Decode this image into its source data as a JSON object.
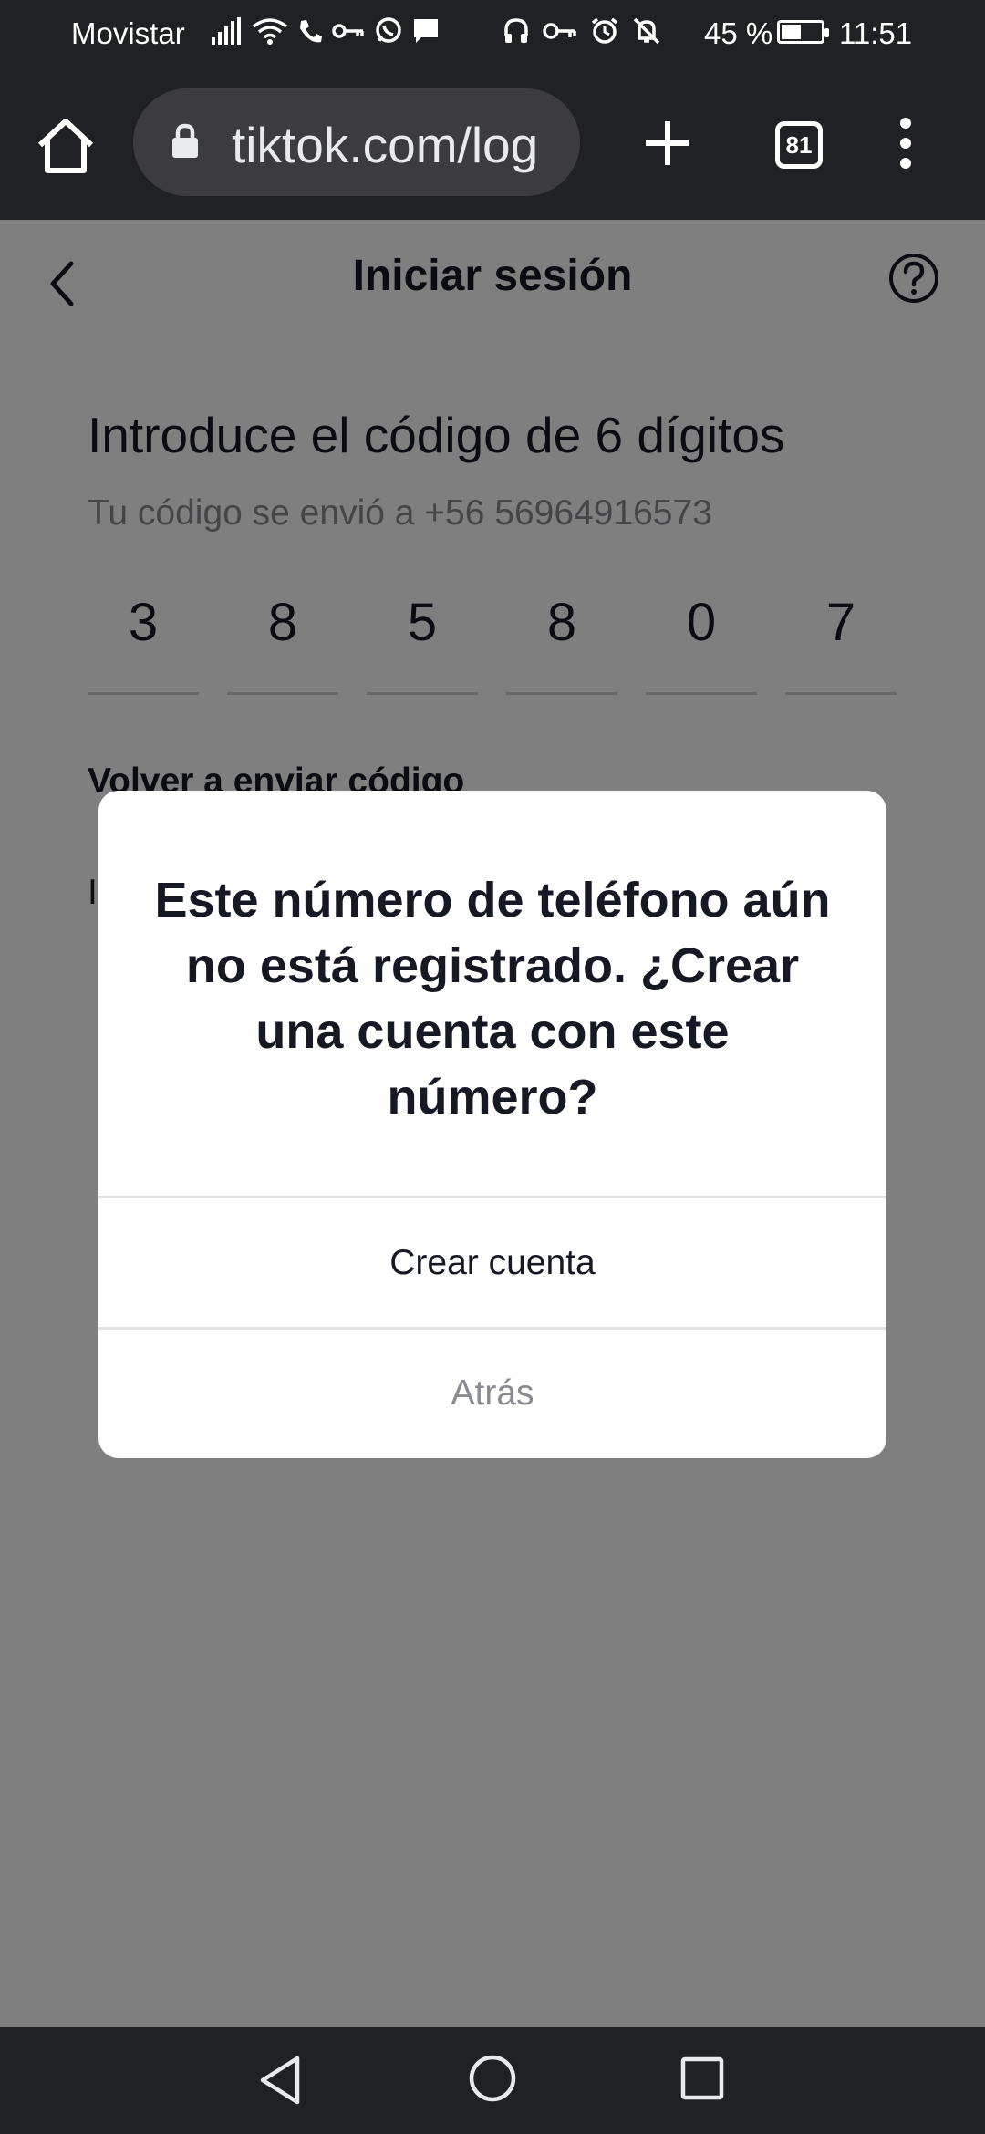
{
  "status_bar": {
    "carrier": "Movistar",
    "battery_percent": "45 %",
    "battery_level": 0.45,
    "time": "11:51",
    "icons": [
      "signal-icon",
      "wifi-icon",
      "phone-icon",
      "key-icon",
      "whatsapp-icon",
      "message-icon",
      "headphones-icon",
      "vpn-key-icon",
      "alarm-icon",
      "bell-off-icon",
      "battery-icon"
    ]
  },
  "browser": {
    "url": "tiktok.com/log",
    "tab_count": "81",
    "icons": [
      "home-icon",
      "lock-icon",
      "plus-icon",
      "tabs-icon",
      "menu-icon"
    ]
  },
  "page": {
    "title": "Iniciar sesión",
    "heading": "Introduce el código de 6 dígitos",
    "subtext": "Tu código se envió a +56 56964916573",
    "code_digits": [
      "3",
      "8",
      "5",
      "8",
      "0",
      "7"
    ],
    "resend_label": "Volver a enviar código",
    "partial_text": "I"
  },
  "dialog": {
    "message": "Este número de teléfono aún no está registrado. ¿Crear una cuenta con este número?",
    "primary_button": "Crear cuenta",
    "secondary_button": "Atrás"
  },
  "colors": {
    "system_bar": "#202124",
    "text_primary": "#161823",
    "text_secondary": "#8a8b91",
    "overlay": "rgba(0,0,0,0.5)"
  }
}
